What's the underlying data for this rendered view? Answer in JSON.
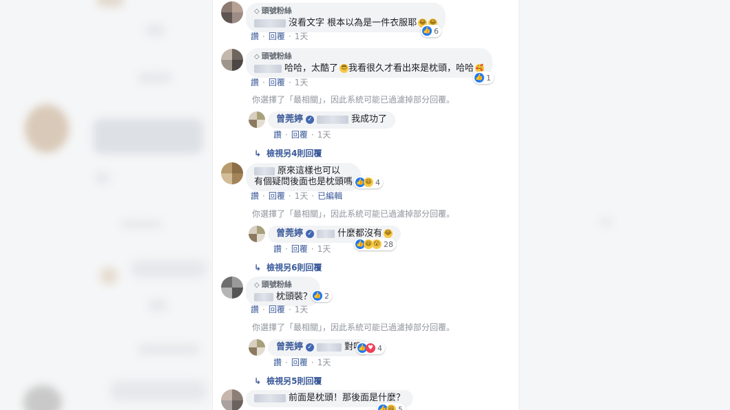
{
  "badge_label": "頭號粉絲",
  "actions": {
    "like": "讚",
    "reply": "回覆",
    "edited": "已編輯"
  },
  "filter_note": "你選擇了「最相關」，因此系統可能已過濾掉部分回覆。",
  "replier_name": "曾莞婷",
  "comments": [
    {
      "text": "沒看文字 根本以為是一件衣服耶",
      "reaction_count": "6",
      "time": "1天"
    },
    {
      "text": "哈哈，太酷了",
      "text2": "我看很久才看出來是枕頭，哈哈",
      "reaction_count": "1",
      "time": "1天"
    },
    {
      "text": "原來這樣也可以",
      "text2": "有個疑問後面也是枕頭嗎",
      "reaction_count": "4",
      "time": "1天"
    },
    {
      "text": "枕頭裝？",
      "reaction_count": "2",
      "time": "1天"
    },
    {
      "text": "前面是枕頭！那後面是什麼？",
      "reaction_count": "5"
    }
  ],
  "replies": [
    {
      "text": "我成功了",
      "time": "1天"
    },
    {
      "text": "什麼都沒有",
      "reaction_count": "28",
      "time": "1天"
    },
    {
      "text": "對呀",
      "reaction_count": "4",
      "time": "1天"
    }
  ],
  "more_replies": [
    "檢視另4則回覆",
    "檢視另6則回覆",
    "檢視另5則回覆"
  ],
  "colors": {
    "link": "#385898",
    "bubble": "#f2f3f5",
    "like": "#2078f4",
    "muted": "#90949c"
  }
}
